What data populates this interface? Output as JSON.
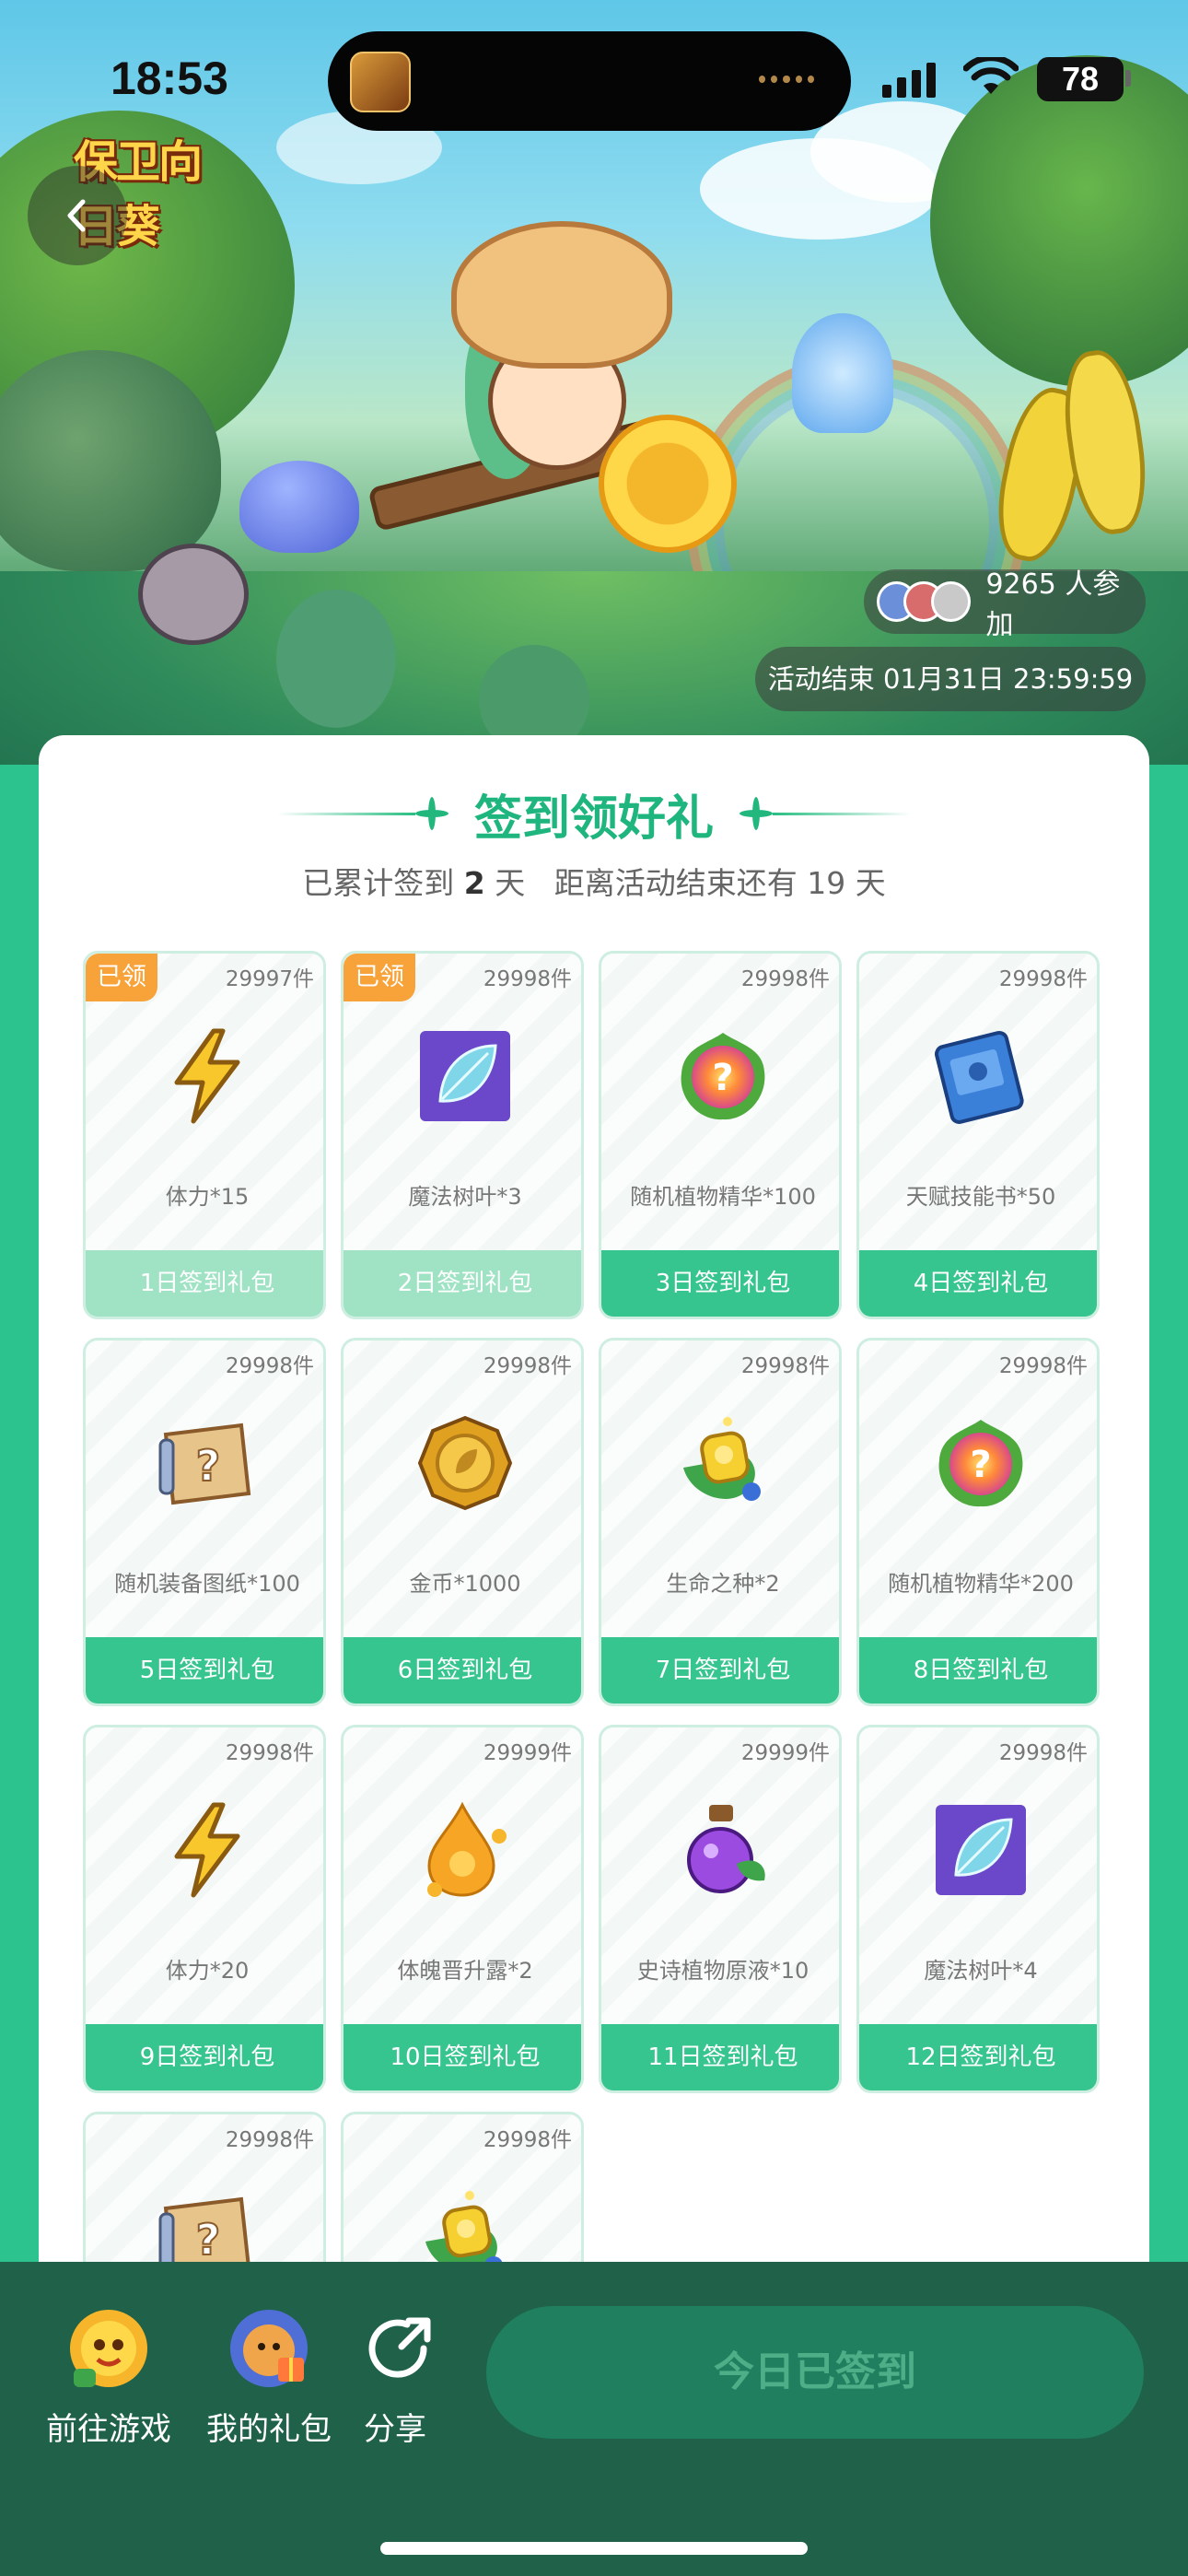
{
  "status_bar": {
    "time": "18:53",
    "battery": "78"
  },
  "banner": {
    "game_logo_text": "保卫向日葵",
    "participants": "9265 人参加",
    "end_time": "活动结束 01月31日 23:59:59"
  },
  "header": {
    "title": "签到领好礼",
    "progress_prefix": "已累计签到",
    "days_signed": "2",
    "days_unit": "天",
    "remaining_text": "距离活动结束还有 19 天"
  },
  "gifts": [
    {
      "badge": "已领",
      "stock": "29997件",
      "name": "体力*15",
      "label": "1日签到礼包",
      "claimed": true,
      "icon": "lightning-icon"
    },
    {
      "badge": "已领",
      "stock": "29998件",
      "name": "魔法树叶*3",
      "label": "2日签到礼包",
      "claimed": true,
      "icon": "magic-leaf-icon"
    },
    {
      "badge": "",
      "stock": "29998件",
      "name": "随机植物精华*100",
      "label": "3日签到礼包",
      "claimed": false,
      "icon": "plant-essence-icon"
    },
    {
      "badge": "",
      "stock": "29998件",
      "name": "天赋技能书*50",
      "label": "4日签到礼包",
      "claimed": false,
      "icon": "skill-book-icon"
    },
    {
      "badge": "",
      "stock": "29998件",
      "name": "随机装备图纸*100",
      "label": "5日签到礼包",
      "claimed": false,
      "icon": "blueprint-icon"
    },
    {
      "badge": "",
      "stock": "29998件",
      "name": "金币*1000",
      "label": "6日签到礼包",
      "claimed": false,
      "icon": "gold-coin-icon"
    },
    {
      "badge": "",
      "stock": "29998件",
      "name": "生命之种*2",
      "label": "7日签到礼包",
      "claimed": false,
      "icon": "life-seed-icon"
    },
    {
      "badge": "",
      "stock": "29998件",
      "name": "随机植物精华*200",
      "label": "8日签到礼包",
      "claimed": false,
      "icon": "plant-essence-icon"
    },
    {
      "badge": "",
      "stock": "29998件",
      "name": "体力*20",
      "label": "9日签到礼包",
      "claimed": false,
      "icon": "lightning-icon"
    },
    {
      "badge": "",
      "stock": "29999件",
      "name": "体魄晋升露*2",
      "label": "10日签到礼包",
      "claimed": false,
      "icon": "dew-drop-icon"
    },
    {
      "badge": "",
      "stock": "29999件",
      "name": "史诗植物原液*10",
      "label": "11日签到礼包",
      "claimed": false,
      "icon": "potion-icon"
    },
    {
      "badge": "",
      "stock": "29998件",
      "name": "魔法树叶*4",
      "label": "12日签到礼包",
      "claimed": false,
      "icon": "magic-leaf-icon"
    },
    {
      "badge": "",
      "stock": "29998件",
      "name": "",
      "label": "",
      "claimed": false,
      "icon": "blueprint-icon"
    },
    {
      "badge": "",
      "stock": "29998件",
      "name": "",
      "label": "",
      "claimed": false,
      "icon": "life-seed-icon"
    }
  ],
  "bottom_bar": {
    "go_game": "前往游戏",
    "my_gifts": "我的礼包",
    "share": "分享",
    "signin_button": "今日已签到"
  },
  "colors": {
    "accent": "#2dc38f",
    "footer_active": "#36c58e",
    "footer_claimed": "#9fe2c4",
    "badge": "#f8a23a",
    "bottom_bar": "#1f6149"
  }
}
